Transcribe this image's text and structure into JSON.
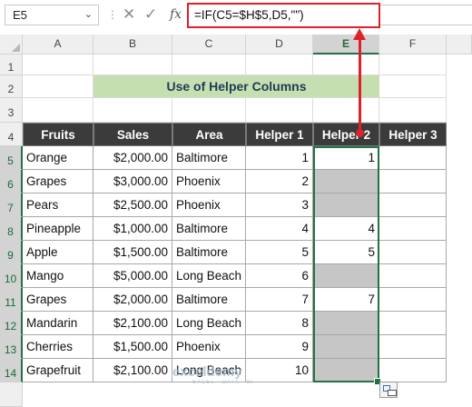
{
  "formula_bar": {
    "name_box": "E5",
    "cancel_icon": "✕",
    "enter_icon": "✓",
    "fx_label": "fx",
    "formula": "=IF(C5=$H$5,D5,\"\")"
  },
  "column_headers": [
    "A",
    "B",
    "C",
    "D",
    "E",
    "F"
  ],
  "row_numbers": [
    "1",
    "2",
    "3",
    "4",
    "5",
    "6",
    "7",
    "8",
    "9",
    "10",
    "11",
    "12",
    "13",
    "14"
  ],
  "sheet": {
    "title": "Use of Helper Columns",
    "table_headers": [
      "Fruits",
      "Sales",
      "Area",
      "Helper 1",
      "Helper 2",
      "Helper 3"
    ],
    "rows": [
      {
        "fruit": "Orange",
        "sales": "$2,000.00",
        "area": "Baltimore",
        "h1": "1",
        "h2": "1",
        "h3": ""
      },
      {
        "fruit": "Grapes",
        "sales": "$3,000.00",
        "area": "Phoenix",
        "h1": "2",
        "h2": "",
        "h3": ""
      },
      {
        "fruit": "Pears",
        "sales": "$2,500.00",
        "area": "Phoenix",
        "h1": "3",
        "h2": "",
        "h3": ""
      },
      {
        "fruit": "Pineapple",
        "sales": "$1,000.00",
        "area": "Baltimore",
        "h1": "4",
        "h2": "4",
        "h3": ""
      },
      {
        "fruit": "Apple",
        "sales": "$1,500.00",
        "area": "Baltimore",
        "h1": "5",
        "h2": "5",
        "h3": ""
      },
      {
        "fruit": "Mango",
        "sales": "$5,000.00",
        "area": "Long Beach",
        "h1": "6",
        "h2": "",
        "h3": ""
      },
      {
        "fruit": "Grapes",
        "sales": "$2,000.00",
        "area": "Baltimore",
        "h1": "7",
        "h2": "7",
        "h3": ""
      },
      {
        "fruit": "Mandarin",
        "sales": "$2,100.00",
        "area": "Long Beach",
        "h1": "8",
        "h2": "",
        "h3": ""
      },
      {
        "fruit": "Cherries",
        "sales": "$1,500.00",
        "area": "Phoenix",
        "h1": "9",
        "h2": "",
        "h3": ""
      },
      {
        "fruit": "Grapefruit",
        "sales": "$2,100.00",
        "area": "Long Beach",
        "h1": "10",
        "h2": "",
        "h3": ""
      }
    ]
  },
  "watermark": {
    "name": "exceldemy",
    "sub": "EXCEL · DATA · BI"
  },
  "colors": {
    "accent_red": "#e0202a",
    "excel_green": "#217346",
    "title_fill": "#c6dfb0",
    "header_fill": "#3b3b3b",
    "blank_fill": "#c6c6c6"
  }
}
